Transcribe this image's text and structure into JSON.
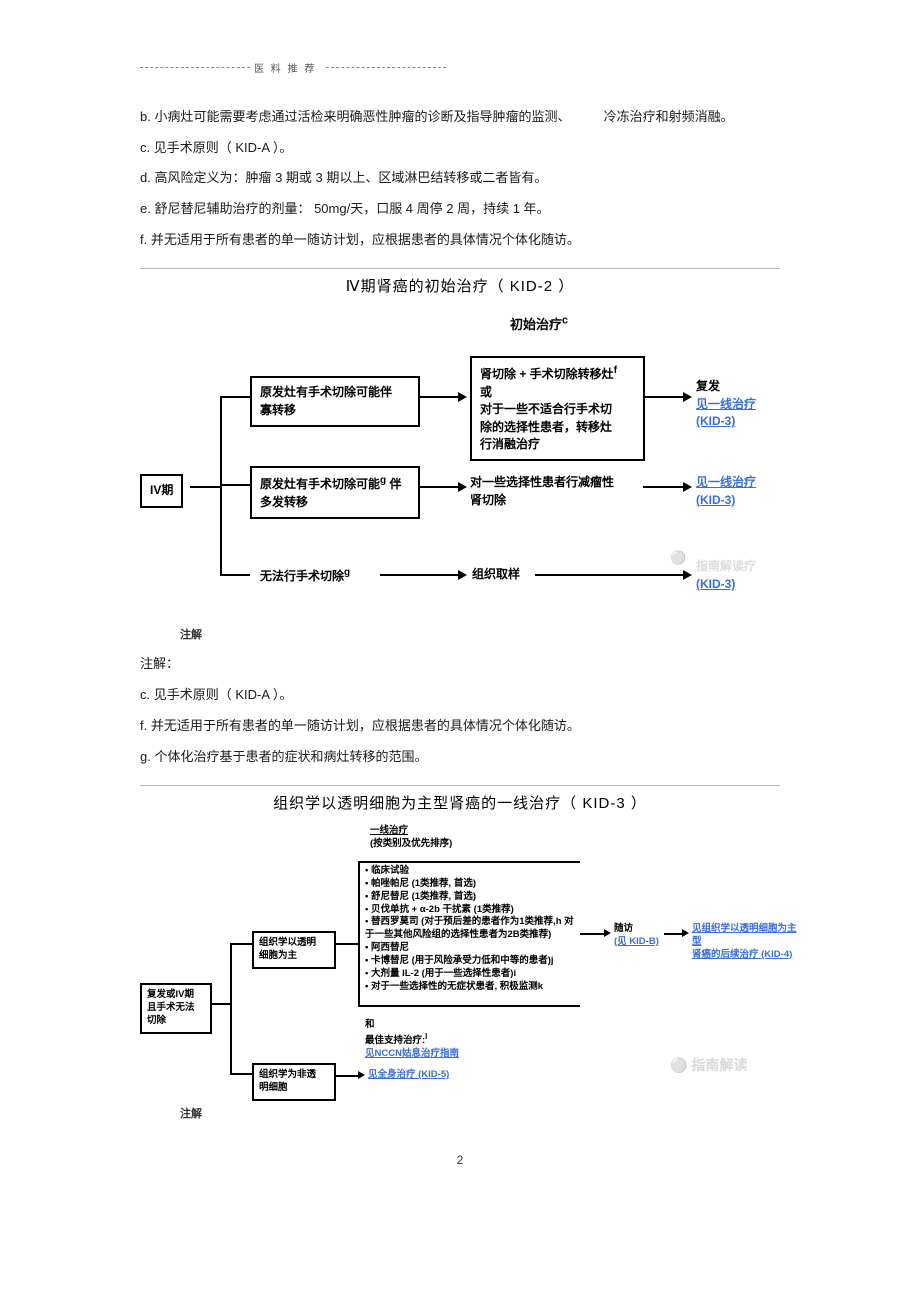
{
  "header": {
    "label": "医   料 推 荐"
  },
  "notes_top": {
    "b_l": "b. 小病灶可能需要考虑通过活检来明确恶性肿瘤的诊断及指导肿瘤的监测、",
    "b_r": "冷冻治疗和射频消融。",
    "c": "c. 见手术原则（  KID-A ）。",
    "d": "d. 高风险定义为：肿瘤    3 期或 3 期以上、区域淋巴结转移或二者皆有。",
    "e": "e. 舒尼替尼辅助治疗的剂量：      50mg/天，口服  4 周停 2 周，持续  1 年。",
    "f": "f.  并无适用于所有患者的单一随访计划，应根据患者的具体情况个体化随访。"
  },
  "section1": {
    "title": "Ⅳ期肾癌的初始治疗（     KID-2 ）",
    "header": "初始治疗",
    "header_sup": "c",
    "start": "IV期",
    "branch1": "原发灶有手术切除可能伴寡转移",
    "branch1_line1": "原发灶有手术切除可能伴",
    "branch1_line2": "寡转移",
    "mid1_line1": "肾切除 + 手术切除转移灶",
    "mid1_sup": "f",
    "mid1_line2": "或",
    "mid1_line3": "对于一些不适合行手术切",
    "mid1_line4": "除的选择性患者，转移灶",
    "mid1_line5": "行消融治疗",
    "out1_a": "复发",
    "out1_b": "见一线治疗",
    "out1_c": "(KID-3)",
    "branch2_line1": "原发灶有手术切除可能",
    "branch2_sup": "g",
    "branch2_line2": "伴",
    "branch2_line3": "多发转移",
    "mid2_line1": "对一些选择性患者行减瘤性",
    "mid2_line2": "肾切除",
    "out2_a": "见一线治疗",
    "out2_b": "(KID-3)",
    "branch3": "无法行手术切除",
    "branch3_sup": "g",
    "mid3": "组织取样",
    "out3_a": "指南解读疗",
    "out3_b": "(KID-3)",
    "footlabel": "注解"
  },
  "notes_mid": {
    "intro": "注解：",
    "c": "c. 见手术原则（  KID-A ）。",
    "f": "f.  并无适用于所有患者的单一随访计划，应根据患者的具体情况个体化随访。",
    "g": "g. 个体化治疗基于患者的症状和病灶转移的范围。"
  },
  "section2": {
    "title": "组织学以透明细胞为主型肾癌的一线治疗（  KID-3 ）",
    "header1": "一线治疗",
    "header2": "(按类别及优先排序)",
    "start_line1": "复发或IV期",
    "start_line2": "且手术无法",
    "start_line3": "切除",
    "branch_a_line1": "组织学以透明",
    "branch_a_line2": "细胞为主",
    "branch_b_line1": "组织学为非透",
    "branch_b_line2": "明细胞",
    "branch_b_link": "见全身治疗 (KID-5)",
    "bullets": [
      "临床试验",
      "帕唑帕尼 (1类推荐, 首选)",
      "舒尼替尼 (1类推荐, 首选)",
      "贝伐单抗 + α-2b 干扰素 (1类推荐)",
      "替西罗莫司 (对于预后差的患者作为1类推荐,h 对于一些其他风险组的选择性患者为2B类推荐)",
      "阿西替尼",
      "卡博替尼 (用于风险承受力低和中等的患者)j",
      "大剂量 IL-2 (用于一些选择性患者)i",
      "对于一些选择性的无症状患者, 积极监测k"
    ],
    "and_label": "和",
    "best_support": "最佳支持治疗:",
    "best_support_sup": "l",
    "nccn_link": "见NCCN姑息治疗指南",
    "followup_label": "随访",
    "followup_sub": "(见 KID-B)",
    "out_link_line1": "见组织学以透明细胞为主型",
    "out_link_line2": "肾癌的后续治疗 (KID-4)",
    "watermark": "指南解读",
    "footlabel": "注解"
  },
  "page_number": "2"
}
